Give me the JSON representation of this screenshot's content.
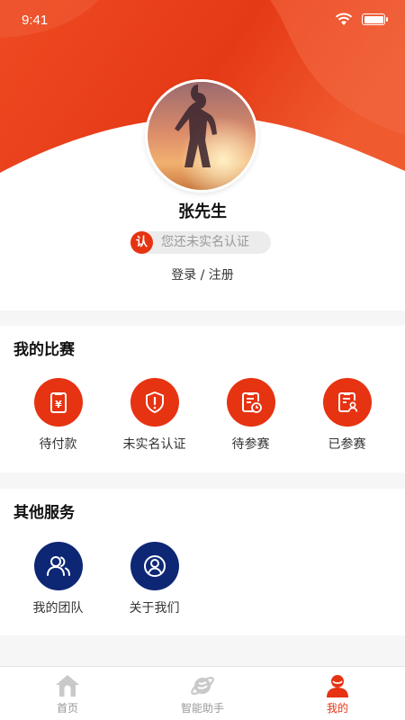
{
  "status_bar": {
    "time": "9:41"
  },
  "profile": {
    "name": "张先生",
    "verify_badge": "认",
    "verify_text": "您还未实名认证",
    "auth_links": "登录 / 注册"
  },
  "my_matches": {
    "title": "我的比赛",
    "items": [
      {
        "label": "待付款",
        "icon": "payment-pending-icon"
      },
      {
        "label": "未实名认证",
        "icon": "shield-alert-icon"
      },
      {
        "label": "待参赛",
        "icon": "clipboard-clock-icon"
      },
      {
        "label": "已参赛",
        "icon": "clipboard-user-icon"
      }
    ]
  },
  "other_services": {
    "title": "其他服务",
    "items": [
      {
        "label": "我的团队",
        "icon": "team-icon"
      },
      {
        "label": "关于我们",
        "icon": "about-user-icon"
      }
    ]
  },
  "tabbar": {
    "items": [
      {
        "label": "首页",
        "icon": "home-icon",
        "active": false
      },
      {
        "label": "智能助手",
        "icon": "planet-icon",
        "active": false
      },
      {
        "label": "我的",
        "icon": "profile-icon",
        "active": true
      }
    ]
  },
  "colors": {
    "accent": "#e63312",
    "navy": "#0d2775",
    "inactive": "#999999"
  }
}
